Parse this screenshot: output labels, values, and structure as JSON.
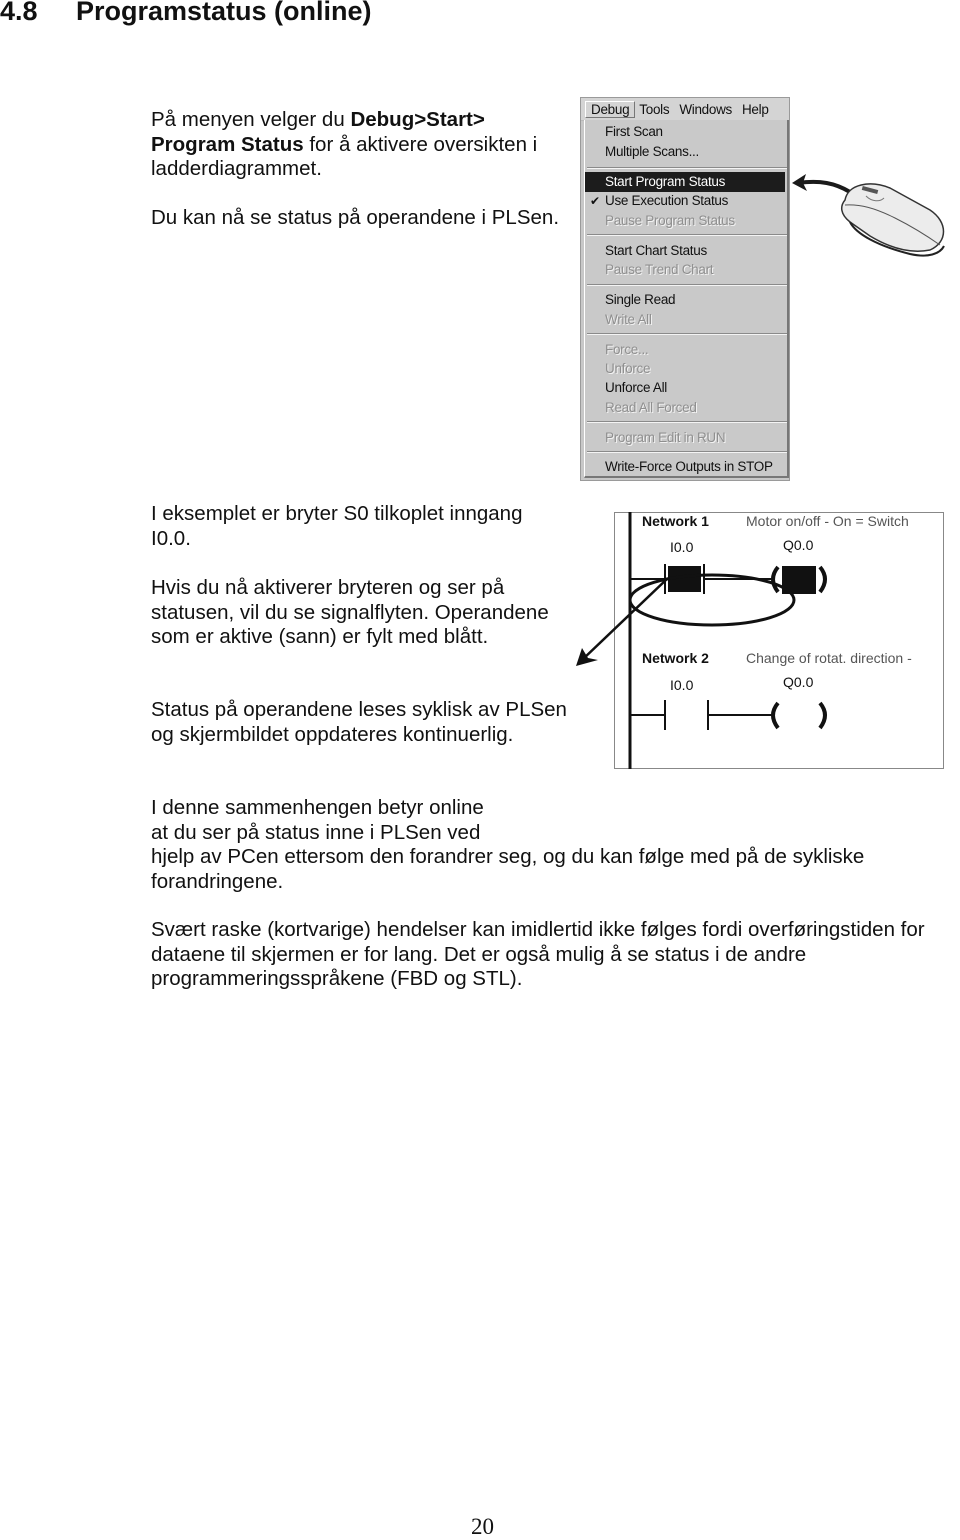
{
  "heading": {
    "number": "4.8",
    "title": "Programstatus (online)"
  },
  "paragraphs": {
    "p1_pre": "På menyen velger du ",
    "p1_bold1": "Debug>Start>",
    "p1_bold2": "Program Status",
    "p1_post": " for å aktivere oversikten i ladderdiagrammet.",
    "p2": "Du kan nå se status på operandene i PLSen.",
    "p3": "I eksemplet er bryter S0 tilkoplet inngang I0.0.",
    "p4": "Hvis du nå aktiverer bryteren og ser på statusen, vil du se signalflyten. Operandene som er aktive (sann) er fylt med blått.",
    "p5": "Status på operandene leses syklisk av PLSen og skjermbildet oppdateres kontinuerlig.",
    "p6_line1": "I denne sammenhengen betyr online",
    "p6_line2": "at du ser på status inne i PLSen ved",
    "p6_rest": "hjelp av PCen ettersom den forandrer seg, og du kan følge med på de sykliske forandringene.",
    "p7": "Svært raske (kortvarige) hendelser kan imidlertid ikke følges fordi overføringstiden for dataene til skjermen er for lang. Det er også mulig å se status i de andre programmeringsspråkene (FBD og STL)."
  },
  "menu_screenshot": {
    "menubar": [
      "Debug",
      "Tools",
      "Windows",
      "Help"
    ],
    "active_menu": "Debug",
    "items": [
      {
        "label": "First Scan",
        "state": "enabled"
      },
      {
        "label": "Multiple Scans...",
        "state": "enabled"
      },
      {
        "label": "Start Program Status",
        "state": "highlighted"
      },
      {
        "label": "Use Execution Status",
        "state": "checked"
      },
      {
        "label": "Pause Program Status",
        "state": "disabled"
      },
      {
        "label": "Start Chart Status",
        "state": "enabled"
      },
      {
        "label": "Pause Trend Chart",
        "state": "disabled"
      },
      {
        "label": "Single Read",
        "state": "enabled"
      },
      {
        "label": "Write All",
        "state": "disabled"
      },
      {
        "label": "Force...",
        "state": "disabled"
      },
      {
        "label": "Unforce",
        "state": "disabled"
      },
      {
        "label": "Unforce All",
        "state": "enabled"
      },
      {
        "label": "Read All Forced",
        "state": "disabled"
      },
      {
        "label": "Program Edit in RUN",
        "state": "disabled"
      },
      {
        "label": "Write-Force Outputs in STOP",
        "state": "enabled"
      }
    ],
    "check_glyph": "✔"
  },
  "ladder": {
    "network1": {
      "title": "Network 1",
      "comment": "Motor on/off    -    On = Switch",
      "contact": "I0.0",
      "coil": "Q0.0",
      "active": true
    },
    "network2": {
      "title": "Network 2",
      "comment": "Change of rotat. direction    -",
      "contact": "I0.0",
      "coil": "Q0.0",
      "active": false
    }
  },
  "page_number": "20"
}
